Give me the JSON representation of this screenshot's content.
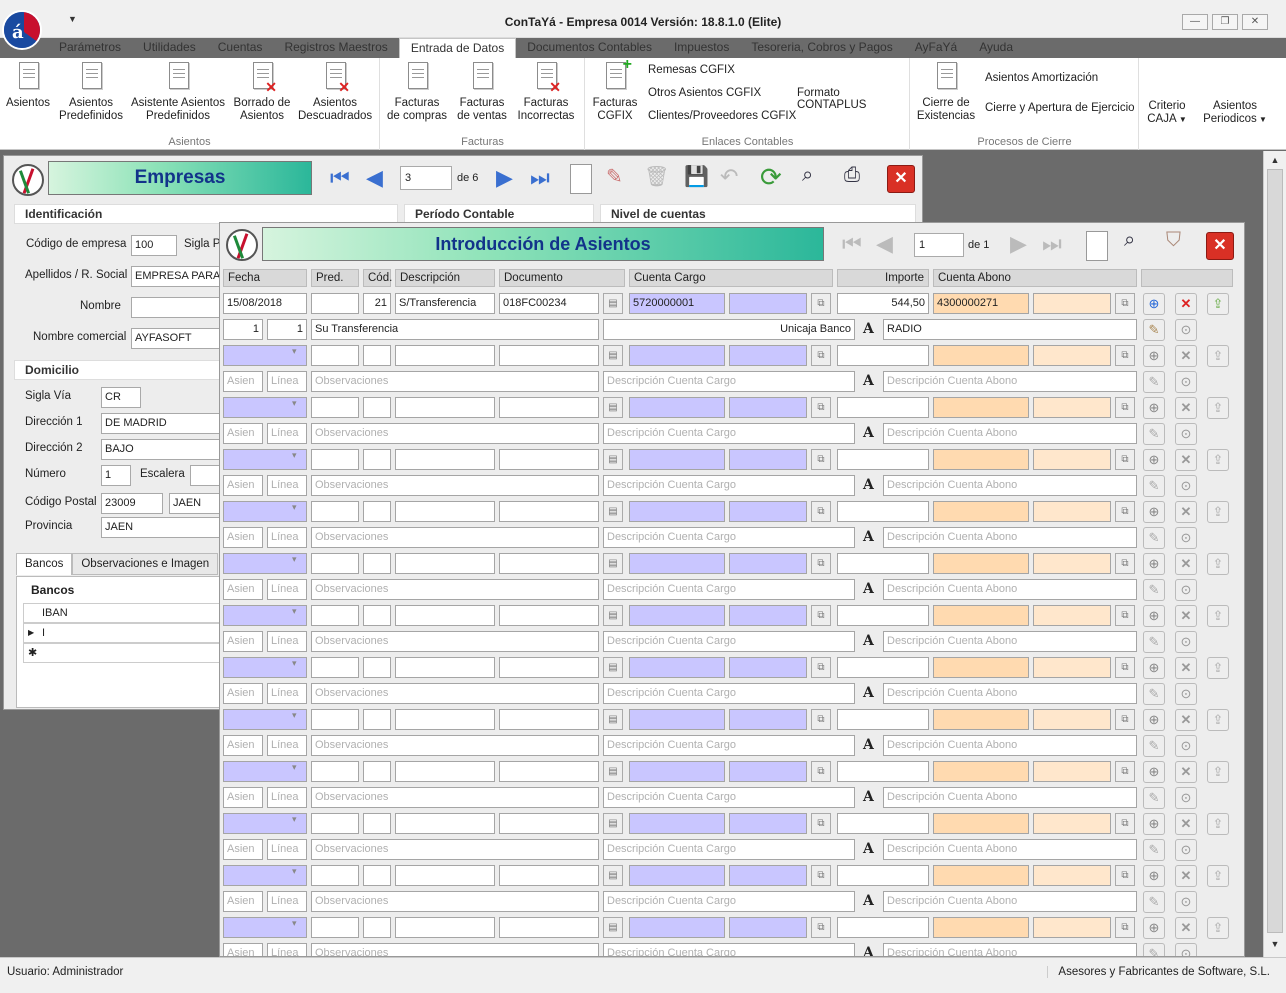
{
  "window": {
    "title": "ConTaYá - Empresa 0014   Versión: 18.8.1.0 (Elite)"
  },
  "menu_tabs": [
    "Parámetros",
    "Utilidades",
    "Cuentas",
    "Registros Maestros",
    "Entrada de Datos",
    "Documentos Contables",
    "Impuestos",
    "Tesoreria, Cobros y Pagos",
    "AyFaYá",
    "Ayuda"
  ],
  "ribbon": {
    "asientos": {
      "group_label": "Asientos",
      "buttons": [
        "Asientos",
        "Asientos\nPredefinidos",
        "Asistente Asientos\nPredefinidos",
        "Borrado de\nAsientos",
        "Asientos\nDescuadrados"
      ]
    },
    "facturas": {
      "group_label": "Facturas",
      "buttons": [
        "Facturas\nde compras",
        "Facturas\nde ventas",
        "Facturas\nIncorrectas"
      ]
    },
    "enlaces": {
      "group_label": "Enlaces Contables",
      "big": "Facturas\nCGFIX",
      "items": [
        "Remesas CGFIX",
        "Otros Asientos CGFIX",
        "Clientes/Proveedores CGFIX",
        "Formato CONTAPLUS"
      ]
    },
    "cierre": {
      "group_label": "Procesos de Cierre",
      "big": "Cierre de\nExistencias",
      "items": [
        "Asientos Amortización",
        "Cierre y Apertura de Ejercicio"
      ]
    },
    "extra": {
      "criterio": "Criterio\nCAJA",
      "periodicos": "Asientos\nPeriodicos"
    }
  },
  "empresas": {
    "title": "Empresas",
    "record": "3",
    "of": "de 6",
    "sections": {
      "identificacion": "Identificación",
      "periodo": "Período Contable",
      "nivel": "Nivel de cuentas",
      "domicilio": "Domicilio"
    },
    "fields": {
      "codigo_label": "Código de empresa",
      "codigo": "100",
      "sigla_label": "Sigla P",
      "apellidos_label": "Apellidos / R. Social",
      "apellidos": "EMPRESA PARA P",
      "nombre_label": "Nombre",
      "nombre": "",
      "comercial_label": "Nombre comercial",
      "comercial": "AYFASOFT",
      "sigla_via_label": "Sigla Vía",
      "sigla_via": "CR",
      "dir1_label": "Dirección 1",
      "dir1": "DE MADRID",
      "dir2_label": "Dirección 2",
      "dir2": "BAJO",
      "numero_label": "Número",
      "numero": "1",
      "escalera_label": "Escalera",
      "cp_label": "Código Postal",
      "cp": "23009",
      "poblacion": "JAEN",
      "provincia_label": "Provincia",
      "provincia": "JAEN"
    },
    "tabs": [
      "Bancos",
      "Observaciones e Imagen"
    ],
    "bancos_title": "Bancos",
    "bancos_col": "IBAN",
    "bancos_row": "I"
  },
  "asientos": {
    "title": "Introducción de Asientos",
    "record": "1",
    "of": "de 1",
    "columns": {
      "fecha": "Fecha",
      "pred": "Pred.",
      "cod": "Cód.",
      "descripcion": "Descripción",
      "documento": "Documento",
      "cargo": "Cuenta Cargo",
      "importe": "Importe",
      "abono": "Cuenta Abono"
    },
    "entry": {
      "fecha": "15/08/2018",
      "pred": "",
      "cod": "21",
      "descripcion": "S/Transferencia",
      "documento": "018FC00234",
      "cargo": "5720000001",
      "importe": "544,50",
      "abono": "4300000271",
      "asien": "1",
      "linea": "1",
      "observaciones": "Su Transferencia",
      "desc_cargo": "Unicaja Banco",
      "desc_abono": "RADIO"
    },
    "placeholders": {
      "asien": "Asien",
      "linea": "Línea",
      "observaciones": "Observaciones",
      "desc_cargo": "Descripción Cuenta Cargo",
      "desc_abono": "Descripción Cuenta Abono"
    }
  },
  "status": {
    "user": "Usuario: Administrador",
    "company": "Asesores y Fabricantes de Software, S.L."
  }
}
